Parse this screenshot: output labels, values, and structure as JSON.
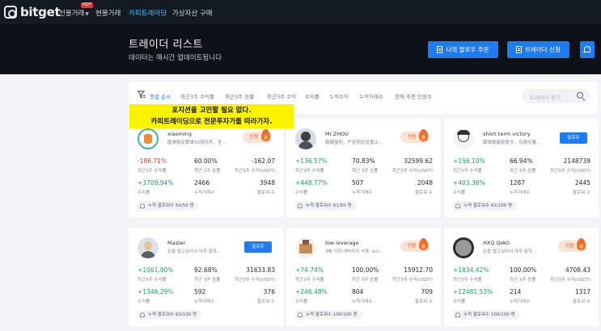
{
  "nav": {
    "logo": "bitget",
    "items": [
      "선물거래",
      "현물거래",
      "카피트레이딩",
      "가상자산 구매"
    ],
    "badge": "HOT"
  },
  "hero": {
    "title": "트레이더 리스트",
    "subtitle": "데이터는 매시간 업데이트됩니다",
    "btn_my_follow": "나의 팔로우 주문",
    "btn_apply": "트레이더 신청",
    "bell_icon": "bell-icon"
  },
  "filters": {
    "tabs": [
      "종합 순서",
      "최근3주 수익률",
      "최근3주 승률",
      "최근3주 수익",
      "수익률",
      "누적수익",
      "누적거래수",
      "현재 추종 인원수"
    ],
    "active_index": 0,
    "search_placeholder": "트레이더 찾기"
  },
  "overlay": {
    "line1": "포지션을 고민할 필요 없다.",
    "line2": "카피트레이딩으로 전문투자가를 따라가자."
  },
  "labels": {
    "roi_3w": "최근3주 수익률",
    "winrate_3w": "최근 3주 승률",
    "profit_3w": "최근3주 수익(USDT)",
    "roi": "수익률",
    "trades": "누적거래수",
    "followers": "팔로워 수",
    "hot": "인원",
    "follow": "팔로우"
  },
  "cards": [
    {
      "name": "xiaoming",
      "desc": "圆滑稳定跟单50倍杠杆，全...",
      "action": "hot",
      "roi3w": "-186.71%",
      "win3w": "60.00%",
      "profit3w": "-162.07",
      "roi": "+3709.94%",
      "trades": "2466",
      "followers": "3948",
      "foot": "누적 팔로워수 50/50 명"
    },
    {
      "name": "Mr.ZHOU",
      "desc": "稳健盈利，严控风险设置止...",
      "action": "hot",
      "roi3w": "+136.57%",
      "win3w": "70.83%",
      "profit3w": "32599.62",
      "roi": "+448.77%",
      "trades": "507",
      "followers": "2048",
      "foot": "누적 팔로워수 61/50 명"
    },
    {
      "name": "short term victory",
      "desc": "跟随稳赢获胜令，功德无量...",
      "action": "follow",
      "roi3w": "+156.10%",
      "win3w": "66.94%",
      "profit3w": "2148739",
      "roi": "+403.36%",
      "trades": "1287",
      "followers": "2445",
      "foot": "누적 팔로워수 92/100 명"
    },
    {
      "name": "Master",
      "desc": "돈을 벌고싶어서 아무 말하...",
      "action": "follow",
      "roi3w": "+1061.90%",
      "win3w": "92.68%",
      "profit3w": "31633.83",
      "roi": "+1346.29%",
      "trades": "592",
      "followers": "376",
      "foot": "누적 팔로워수 83/100 명"
    },
    {
      "name": "low leverage",
      "desc": "3배 이하 레버리지 사용, onl...",
      "action": "hot",
      "roi3w": "+74.74%",
      "win3w": "100.00%",
      "profit3w": "15912.70",
      "roi": "+246.48%",
      "trades": "804",
      "followers": "709",
      "foot": "누적 팔로워수 100/100 명"
    },
    {
      "name": "HXQ QIAO",
      "desc": "돈을 벌고싶어서 아무 말하...",
      "action": "hot",
      "roi3w": "+1834.42%",
      "win3w": "100.00%",
      "profit3w": "4708.43",
      "roi": "+12481.53%",
      "trades": "214",
      "followers": "1317",
      "foot": "누적 팔로워수 100/100 명"
    }
  ]
}
